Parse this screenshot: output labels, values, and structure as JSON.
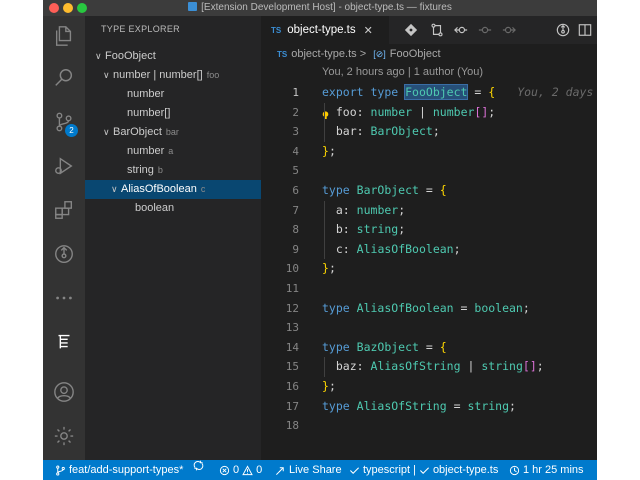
{
  "window": {
    "title": "[Extension Development Host] - object-type.ts — fixtures"
  },
  "activity_bar": {
    "items": [
      {
        "name": "explorer",
        "icon": "files-icon"
      },
      {
        "name": "search",
        "icon": "search-icon"
      },
      {
        "name": "source-control",
        "icon": "source-control-icon",
        "badge": "2"
      },
      {
        "name": "run-debug",
        "icon": "debug-icon"
      },
      {
        "name": "extensions",
        "icon": "extensions-icon"
      },
      {
        "name": "gitlens",
        "icon": "git-commit-icon"
      },
      {
        "name": "more",
        "icon": "ellipsis-icon"
      },
      {
        "name": "type-explorer",
        "icon": "type-hierarchy-icon",
        "active": true
      }
    ],
    "bottom_items": [
      {
        "name": "accounts",
        "icon": "account-icon"
      },
      {
        "name": "manage",
        "icon": "gear-icon"
      }
    ]
  },
  "sidebar": {
    "title": "TYPE EXPLORER",
    "tree": [
      {
        "label": "FooObject",
        "desc": "",
        "depth": 0,
        "chevron": "open"
      },
      {
        "label": "number | number[]",
        "desc": "foo",
        "depth": 1,
        "chevron": "open"
      },
      {
        "label": "number",
        "desc": "",
        "depth": 2,
        "chevron": "none"
      },
      {
        "label": "number[]",
        "desc": "",
        "depth": 2,
        "chevron": "none"
      },
      {
        "label": "BarObject",
        "desc": "bar",
        "depth": 1,
        "chevron": "open"
      },
      {
        "label": "number",
        "desc": "a",
        "depth": 2,
        "chevron": "none"
      },
      {
        "label": "string",
        "desc": "b",
        "depth": 2,
        "chevron": "none"
      },
      {
        "label": "AliasOfBoolean",
        "desc": "c",
        "depth": 2,
        "chevron": "open",
        "selected": true
      },
      {
        "label": "boolean",
        "desc": "",
        "depth": 3,
        "chevron": "none"
      }
    ]
  },
  "editor": {
    "tab": {
      "lang_badge": "TS",
      "label": "object-type.ts",
      "close": "✕"
    },
    "breadcrumb": {
      "lang_badge": "TS",
      "file": "object-type.ts",
      "separator": ">",
      "symbol_icon": "[⊘]",
      "symbol": "FooObject"
    },
    "codelens": "You, 2 hours ago | 1 author (You)",
    "blame": "You, 2 days",
    "current_line": 1,
    "lines": [
      {
        "n": "1",
        "text": "export type FooObject = {"
      },
      {
        "n": "2",
        "text": "  foo: number | number[];"
      },
      {
        "n": "3",
        "text": "  bar: BarObject;"
      },
      {
        "n": "4",
        "text": "};"
      },
      {
        "n": "5",
        "text": ""
      },
      {
        "n": "6",
        "text": "type BarObject = {"
      },
      {
        "n": "7",
        "text": "  a: number;"
      },
      {
        "n": "8",
        "text": "  b: string;"
      },
      {
        "n": "9",
        "text": "  c: AliasOfBoolean;"
      },
      {
        "n": "10",
        "text": "};"
      },
      {
        "n": "11",
        "text": ""
      },
      {
        "n": "12",
        "text": "type AliasOfBoolean = boolean;"
      },
      {
        "n": "13",
        "text": ""
      },
      {
        "n": "14",
        "text": "type BazObject = {"
      },
      {
        "n": "15",
        "text": "  baz: AliasOfString | string[];"
      },
      {
        "n": "16",
        "text": "};"
      },
      {
        "n": "17",
        "text": "type AliasOfString = string;"
      },
      {
        "n": "18",
        "text": ""
      }
    ]
  },
  "status_bar": {
    "branch": "feat/add-support-types*",
    "errors": "0",
    "warnings": "0",
    "live_share": "Live Share",
    "language": "typescript",
    "file": "object-type.ts",
    "separator": "|",
    "time": "1 hr 25 mins"
  },
  "colors": {
    "accent": "#007acc",
    "selection": "#094771",
    "keyword": "#569cd6",
    "type": "#4ec9b0"
  }
}
